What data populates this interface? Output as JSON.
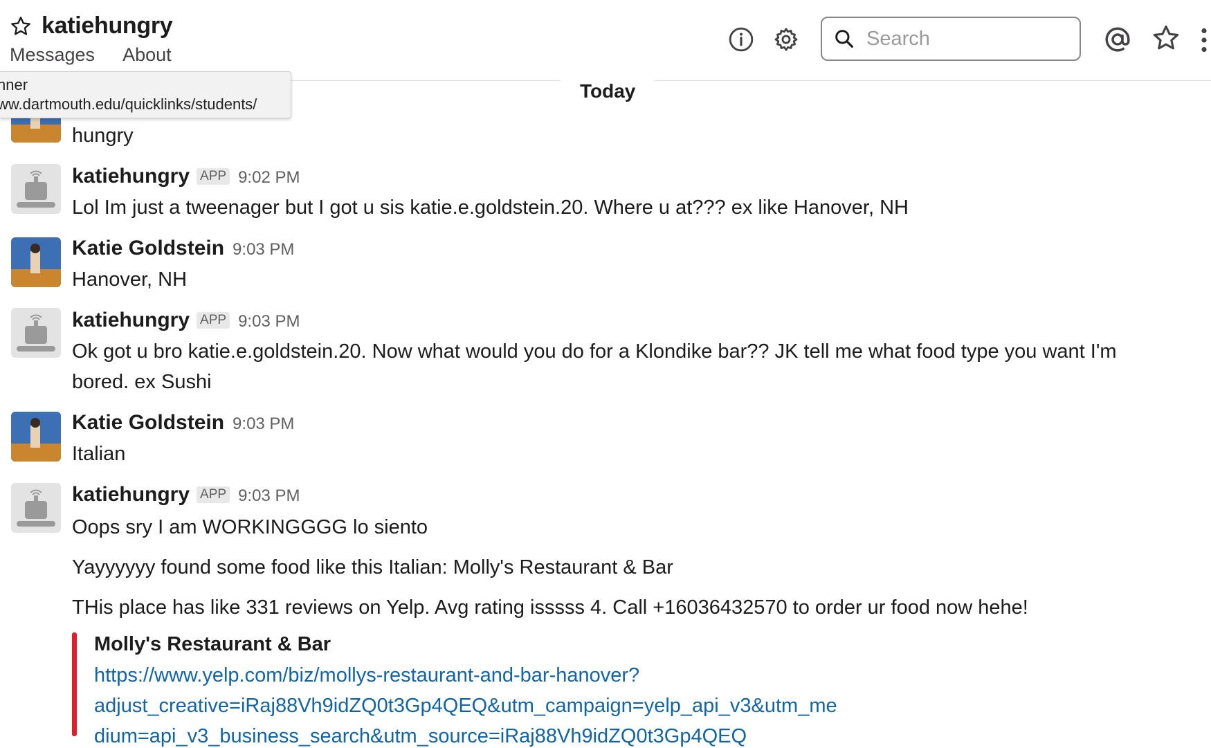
{
  "header": {
    "channel_name": "katiehungry",
    "tabs": [
      "Messages",
      "About"
    ],
    "search_placeholder": "Search"
  },
  "tooltip": {
    "line1": "nner",
    "line2": "ww.dartmouth.edu/quicklinks/students/"
  },
  "divider": {
    "label": "Today"
  },
  "partial_message": {
    "text": "hungry"
  },
  "messages": [
    {
      "author": "katiehungry",
      "badge": "APP",
      "time": "9:02 PM",
      "lines": [
        "Lol Im just a tweenager but I got u sis katie.e.goldstein.20. Where u at??? ex like Hanover, NH"
      ]
    },
    {
      "author": "Katie Goldstein",
      "time": "9:03 PM",
      "lines": [
        "Hanover, NH"
      ]
    },
    {
      "author": "katiehungry",
      "badge": "APP",
      "time": "9:03 PM",
      "lines": [
        "Ok got u bro katie.e.goldstein.20. Now what would you do for a Klondike bar?? JK tell me what food type you want I'm",
        "bored. ex Sushi"
      ]
    },
    {
      "author": "Katie Goldstein",
      "time": "9:03 PM",
      "lines": [
        "Italian"
      ]
    },
    {
      "author": "katiehungry",
      "badge": "APP",
      "time": "9:03 PM",
      "lines": [
        "Oops sry I am WORKINGGGG lo siento",
        "Yayyyyyy found some food like this Italian: Molly's Restaurant & Bar",
        "THis place has like 331 reviews on Yelp. Avg rating isssss 4. Call +16036432570 to order ur food now hehe!"
      ]
    }
  ],
  "attachment": {
    "title": "Molly's Restaurant & Bar",
    "link_lines": [
      "https://www.yelp.com/biz/mollys-restaurant-and-bar-hanover?",
      "adjust_creative=iRaj88Vh9idZQ0t3Gp4QEQ&utm_campaign=yelp_api_v3&utm_me",
      "dium=api_v3_business_search&utm_source=iRaj88Vh9idZQ0t3Gp4QEQ"
    ],
    "accent_color": "#e01e2a"
  }
}
